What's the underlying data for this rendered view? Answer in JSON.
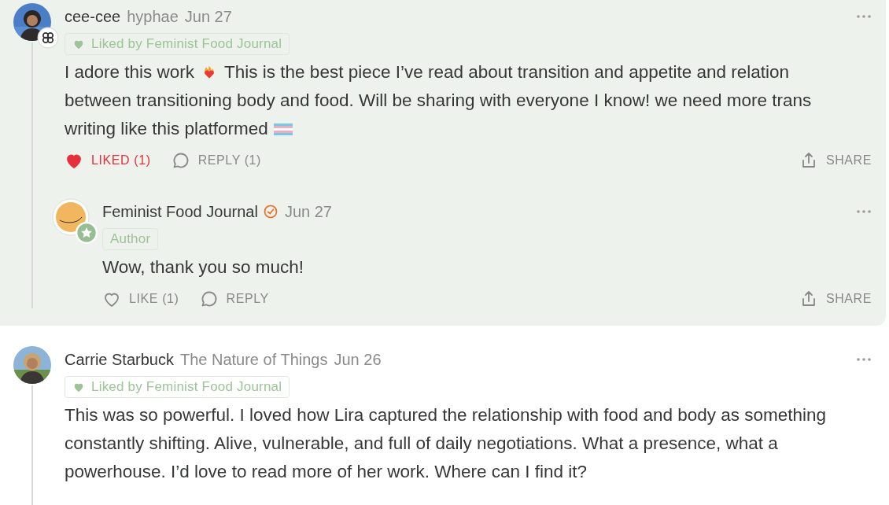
{
  "comments": [
    {
      "author": "cee-cee",
      "publication": "hyphae",
      "date": "Jun 27",
      "kind": "flower",
      "highlighted": true,
      "liked_by": "Liked by Feminist Food Journal",
      "body": [
        {
          "kind": "text",
          "text": "I adore this work"
        },
        {
          "kind": "heart-on-fire"
        },
        {
          "kind": "text",
          "text": "This is the best piece I’ve read about transition and appetite and relation"
        },
        {
          "kind": "text",
          "text": "between transitioning body and food. Will be sharing with everyone I know! we need more trans"
        },
        {
          "kind": "text",
          "text": "writing like this platformed"
        },
        {
          "kind": "trans-flag"
        }
      ],
      "like": {
        "label": "LIKED (1)",
        "liked": true
      },
      "reply": "REPLY (1)",
      "share": "SHARE",
      "replies": [
        {
          "author": "Feminist Food Journal",
          "verified": true,
          "date": "Jun 27",
          "kind": "star",
          "role": "Author",
          "body": [
            {
              "kind": "text",
              "text": "Wow, thank you so much!"
            }
          ],
          "like": {
            "label": "LIKE (1)",
            "liked": false
          },
          "reply": "REPLY",
          "share": "SHARE"
        }
      ]
    },
    {
      "author": "Carrie Starbuck",
      "publication": "The Nature of Things",
      "date": "Jun 26",
      "kind": "plain",
      "highlighted": false,
      "liked_by": "Liked by Feminist Food Journal",
      "body": [
        {
          "kind": "text",
          "text": "This was so powerful. I loved how Lira captured the relationship with food and body as something constantly shifting. Alive, vulnerable, and full of daily negotiations. What a presence, what a powerhouse. I’d love to read more of her work. Where can I find it?"
        }
      ]
    }
  ]
}
